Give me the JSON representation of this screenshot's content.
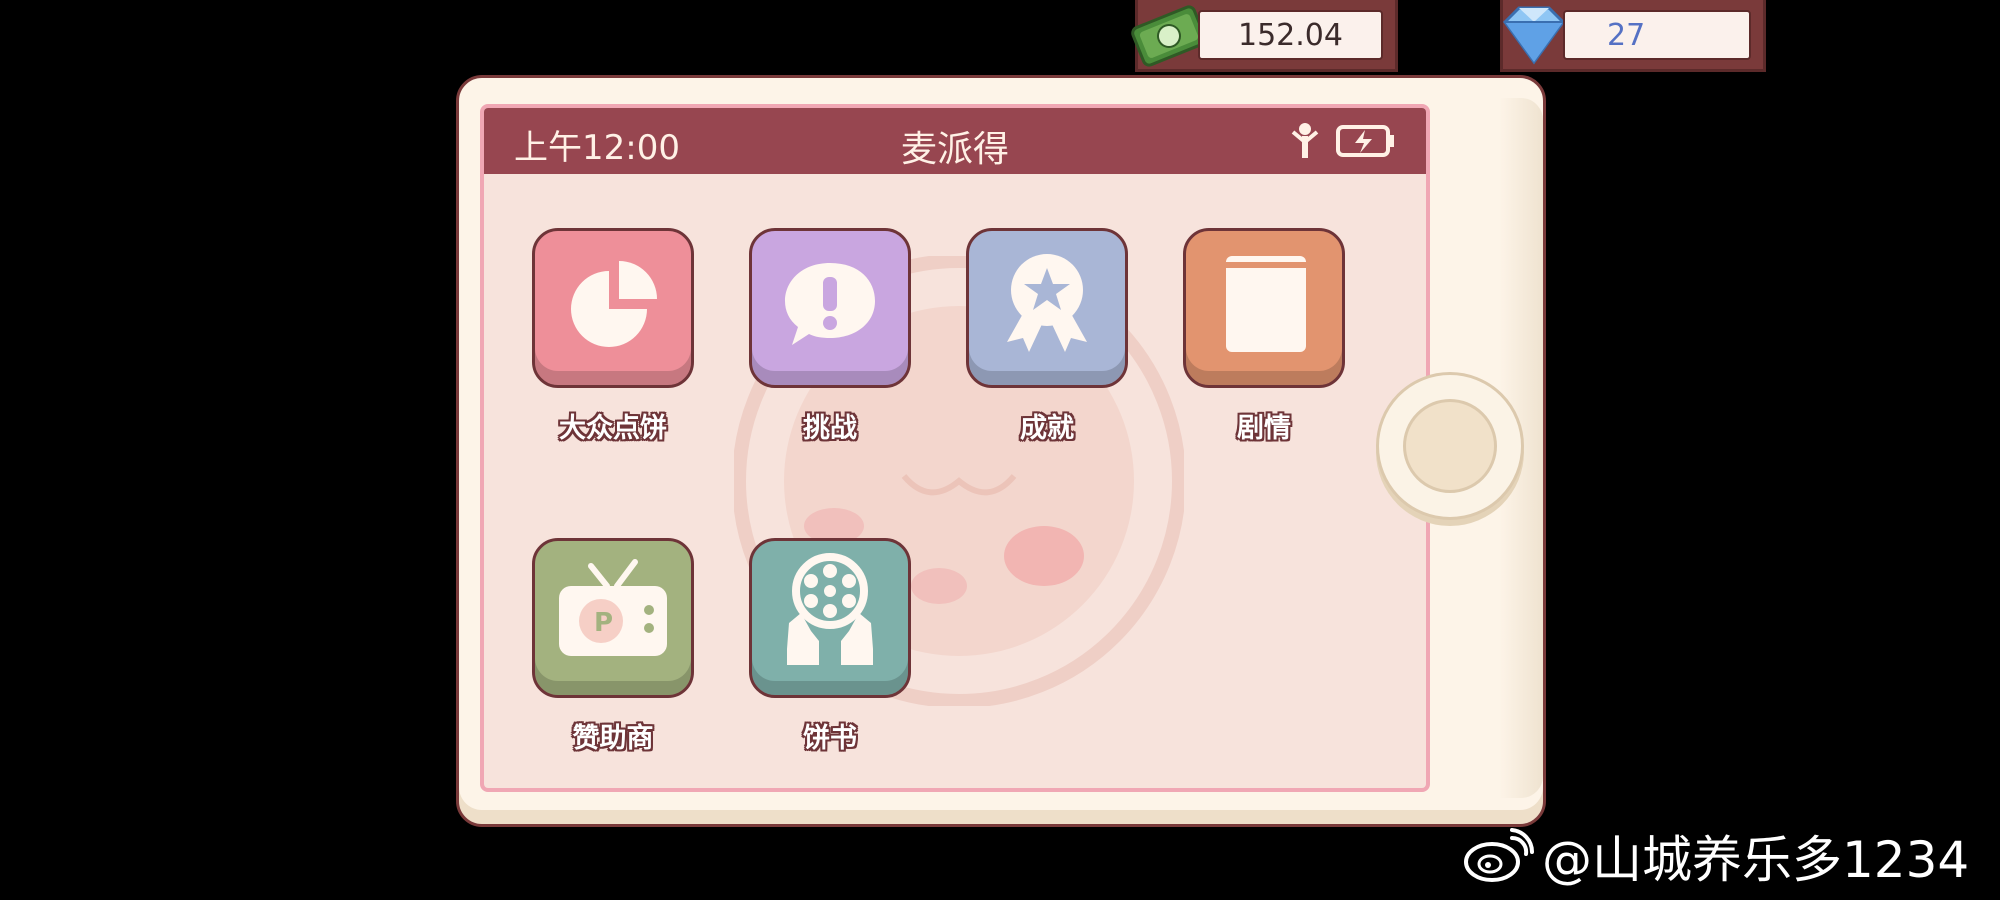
{
  "currency": {
    "money": {
      "value": "152.04",
      "icon": "cash-bill-icon"
    },
    "gems": {
      "value": "27",
      "icon": "diamond-icon"
    }
  },
  "status_bar": {
    "time": "上午12:00",
    "title": "麦派得",
    "signal_icon": "signal-antenna-icon",
    "battery_icon": "battery-charging-icon"
  },
  "apps": [
    {
      "label": "大众点饼",
      "icon": "pie-chart-icon",
      "color": "#ee8f99"
    },
    {
      "label": "挑战",
      "icon": "exclamation-bubble-icon",
      "color": "#c9a6e0"
    },
    {
      "label": "成就",
      "icon": "award-ribbon-icon",
      "color": "#a9b6d6"
    },
    {
      "label": "剧情",
      "icon": "book-icon",
      "color": "#e2946f"
    },
    {
      "label": "赞助商",
      "icon": "tv-icon",
      "color": "#a3b27f"
    },
    {
      "label": "饼书",
      "icon": "film-reel-icon",
      "color": "#7fb0aa"
    }
  ],
  "watermark": {
    "text": "@山城养乐多1234",
    "icon": "weibo-icon"
  }
}
